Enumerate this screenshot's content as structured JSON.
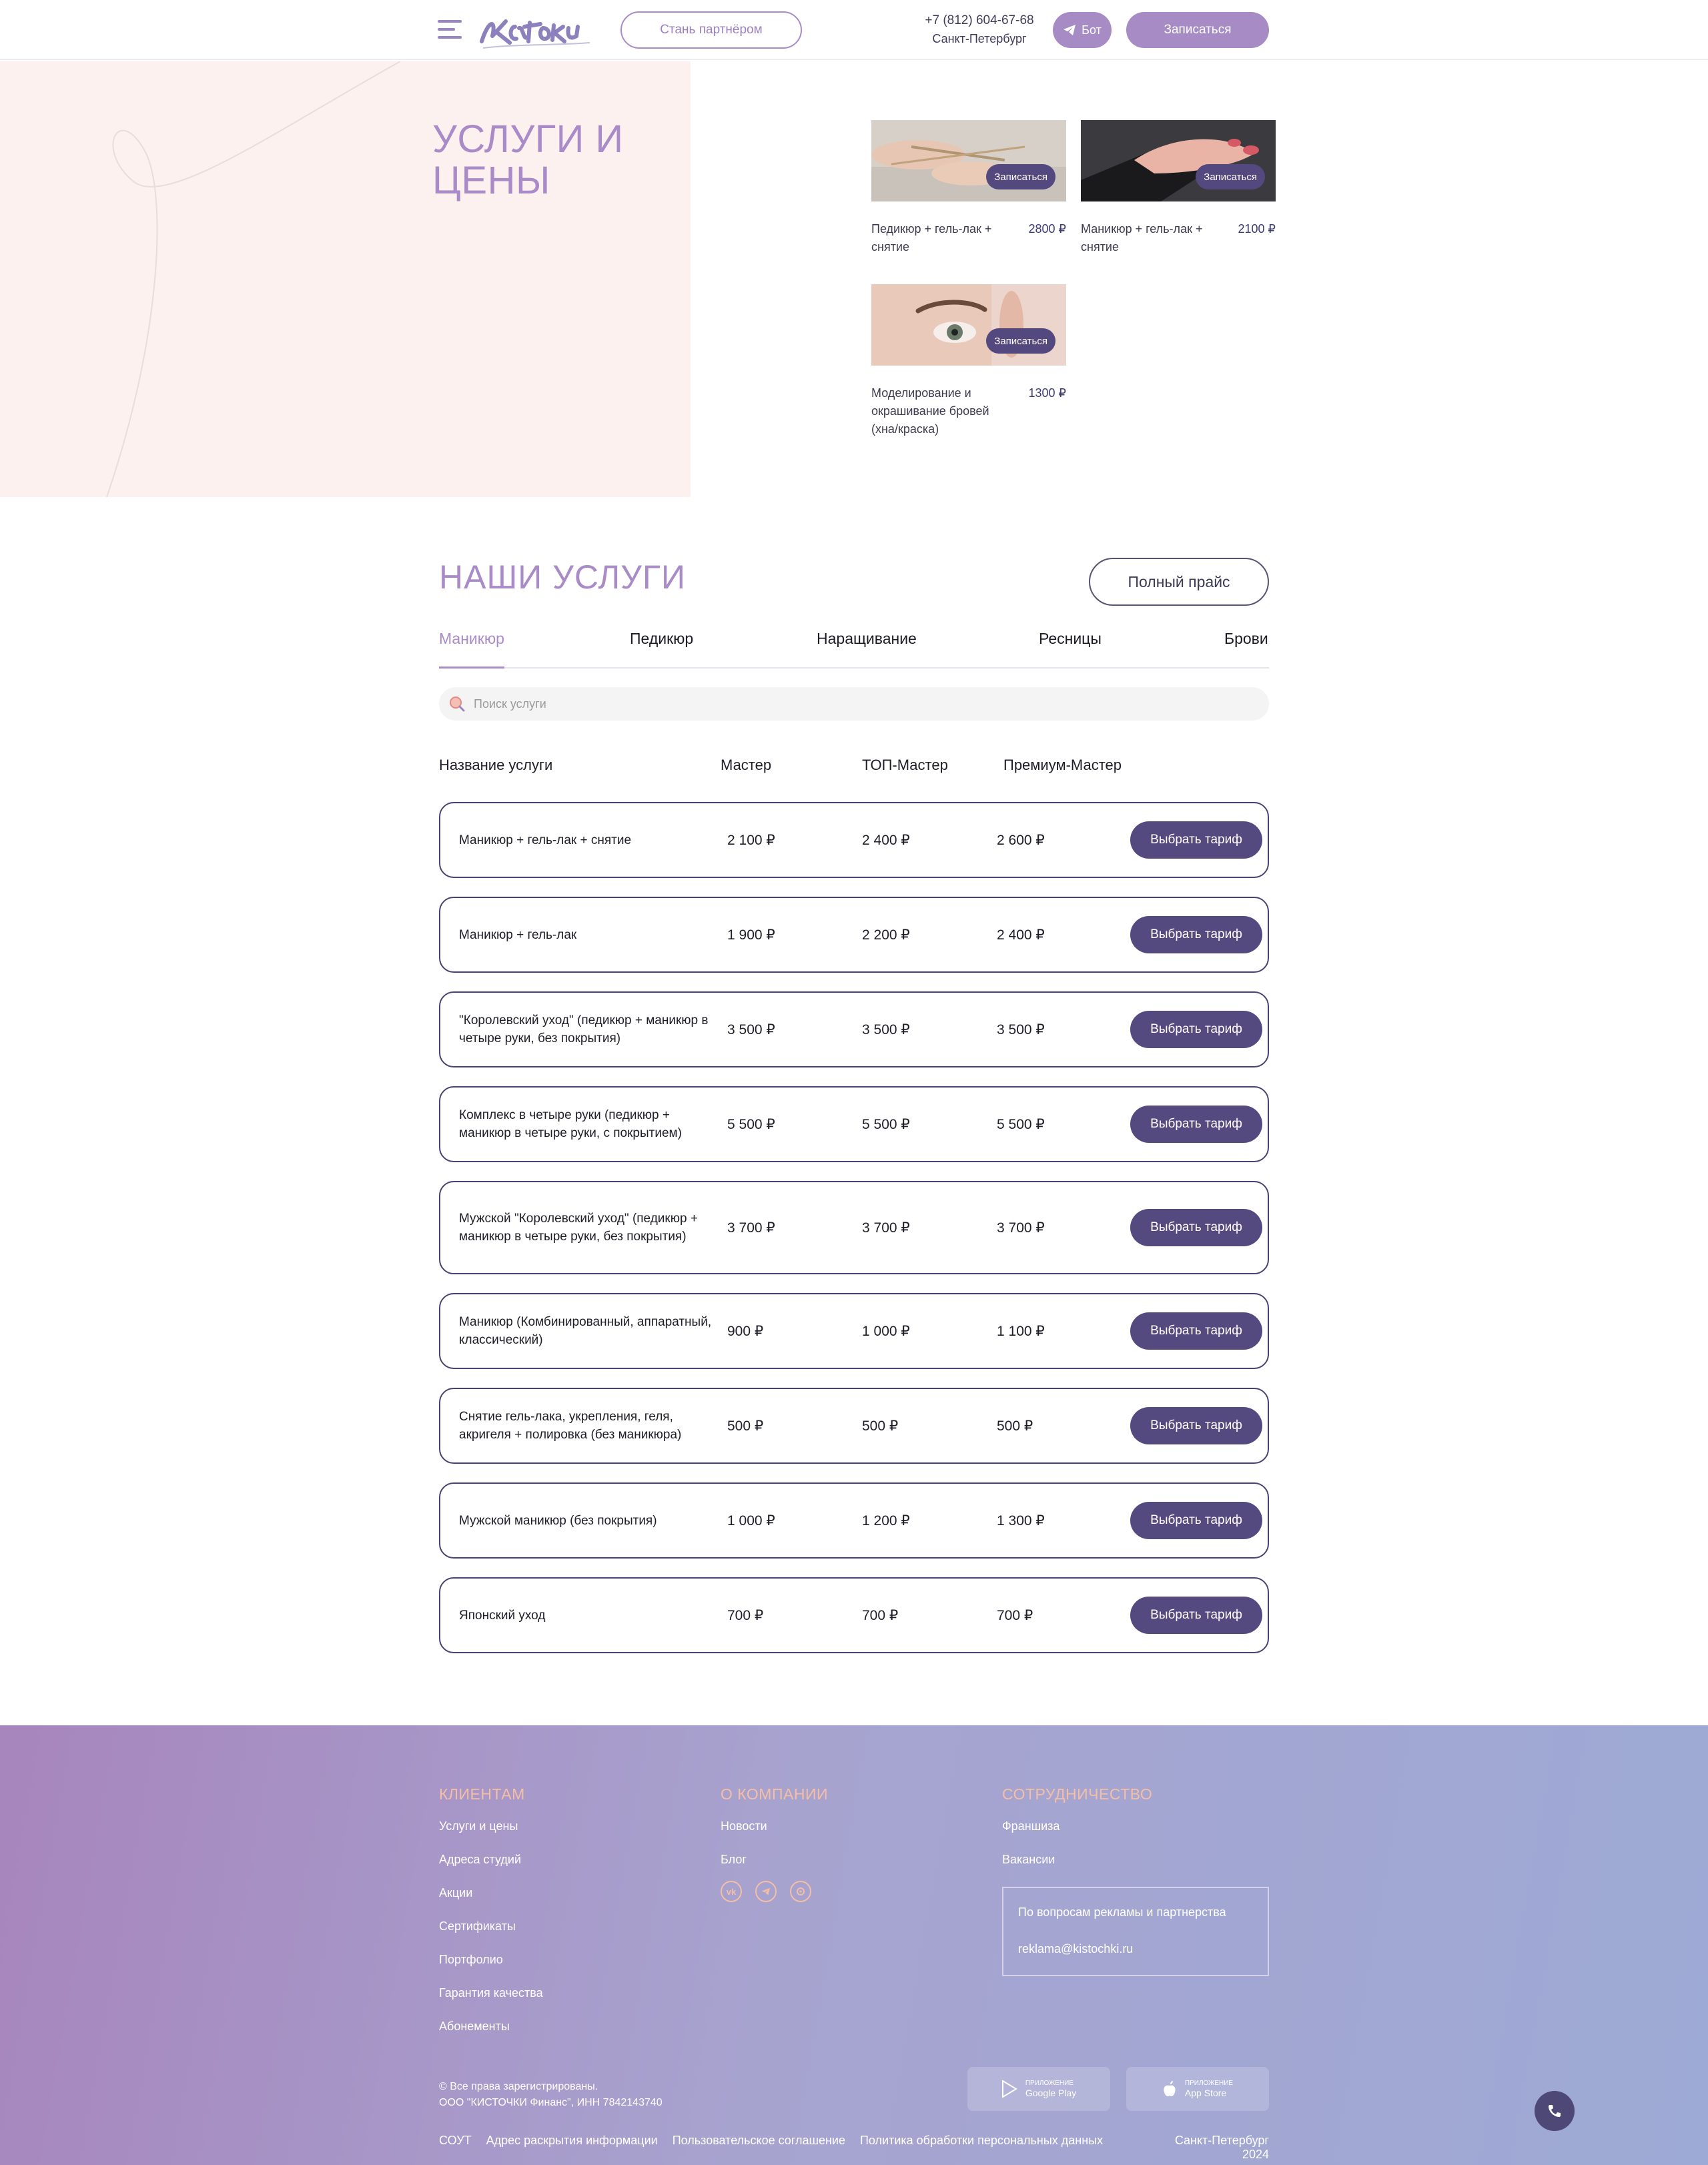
{
  "header": {
    "partner_label": "Стань партнёром",
    "phone": "+7 (812) 604-67-68",
    "city": "Санкт-Петербург",
    "bot_label": "Бот",
    "book_label": "Записаться",
    "logo_text": "Кисточки"
  },
  "hero": {
    "title": "Услуги и цены",
    "cards": [
      {
        "name": "Педикюр + гель-лак + снятие",
        "price": "2800 ₽",
        "book": "Записаться"
      },
      {
        "name": "Маникюр + гель-лак + снятие",
        "price": "2100 ₽",
        "book": "Записаться"
      },
      {
        "name": "Моделирование и окрашивание бровей (хна/краска)",
        "price": "1300 ₽",
        "book": "Записаться"
      }
    ]
  },
  "services": {
    "title": "НАШИ УСЛУГИ",
    "full_price_label": "Полный прайс",
    "tabs": [
      "Маникюр",
      "Педикюр",
      "Наращивание",
      "Ресницы",
      "Брови"
    ],
    "active_tab": "Маникюр",
    "search_placeholder": "Поиск услуги",
    "columns": [
      "Название услуги",
      "Мастер",
      "ТОП-Мастер",
      "Премиум-Мастер"
    ],
    "choose_label": "Выбрать тариф",
    "rows": [
      {
        "name": "Маникюр + гель-лак + снятие",
        "master": "2 100 ₽",
        "top": "2 400 ₽",
        "premium": "2 600 ₽"
      },
      {
        "name": "Маникюр + гель-лак",
        "master": "1 900 ₽",
        "top": "2 200 ₽",
        "premium": "2 400 ₽"
      },
      {
        "name": "\"Королевский уход\" (педикюр + маникюр в четыре руки, без покрытия)",
        "master": "3 500 ₽",
        "top": "3 500 ₽",
        "premium": "3 500 ₽"
      },
      {
        "name": "Комплекс в четыре руки (педикюр + маникюр в четыре руки, с покрытием)",
        "master": "5 500 ₽",
        "top": "5 500 ₽",
        "premium": "5 500 ₽"
      },
      {
        "name": "Мужской \"Королевский уход\" (педикюр + маникюр в четыре руки, без покрытия)",
        "master": "3 700 ₽",
        "top": "3 700 ₽",
        "premium": "3 700 ₽"
      },
      {
        "name": "Маникюр (Комбинированный, аппаратный, классический)",
        "master": "900 ₽",
        "top": "1 000 ₽",
        "premium": "1 100 ₽"
      },
      {
        "name": "Снятие гель-лака, укрепления, геля, акригеля + полировка (без маникюра)",
        "master": "500 ₽",
        "top": "500 ₽",
        "premium": "500 ₽"
      },
      {
        "name": "Мужской маникюр (без покрытия)",
        "master": "1 000 ₽",
        "top": "1 200 ₽",
        "premium": "1 300 ₽"
      },
      {
        "name": "Японский уход",
        "master": "700 ₽",
        "top": "700 ₽",
        "premium": "700 ₽"
      }
    ]
  },
  "footer": {
    "clients_title": "КЛИЕНТАМ",
    "clients_links": [
      "Услуги и цены",
      "Адреса студий",
      "Акции",
      "Сертификаты",
      "Портфолио",
      "Гарантия качества",
      "Абонементы"
    ],
    "company_title": "О КОМПАНИИ",
    "company_links": [
      "Новости",
      "Блог"
    ],
    "partner_title": "СОТРУДНИЧЕСТВО",
    "partner_links": [
      "Франшиза",
      "Вакансии"
    ],
    "ad_text": "По вопросам рекламы и партнерства",
    "ad_email": "reklama@kistochki.ru",
    "copyright_1": "© Все права зарегистрированы.",
    "copyright_2": "ООО \"КИСТОЧКИ Финанс\", ИНН 7842143740",
    "google_small": "ПРИЛОЖЕНИЕ",
    "google_name": "Google Play",
    "apple_small": "ПРИЛОЖЕНИЕ",
    "apple_name": "App Store",
    "legal_links": [
      "СОУТ",
      "Адрес раскрытия информации",
      "Пользовательское соглашение",
      "Политика обработки персональных данных"
    ],
    "city_year": "Санкт-Петербург 2024"
  },
  "colors": {
    "accent": "#a98bc7",
    "dark_button": "#544a80",
    "hero_bg": "#fcf1ef",
    "footer_heading": "#f5bfa6"
  },
  "icons": [
    "menu-icon",
    "telegram-icon",
    "search-icon",
    "vk-icon",
    "google-play-icon",
    "apple-icon",
    "phone-icon"
  ]
}
